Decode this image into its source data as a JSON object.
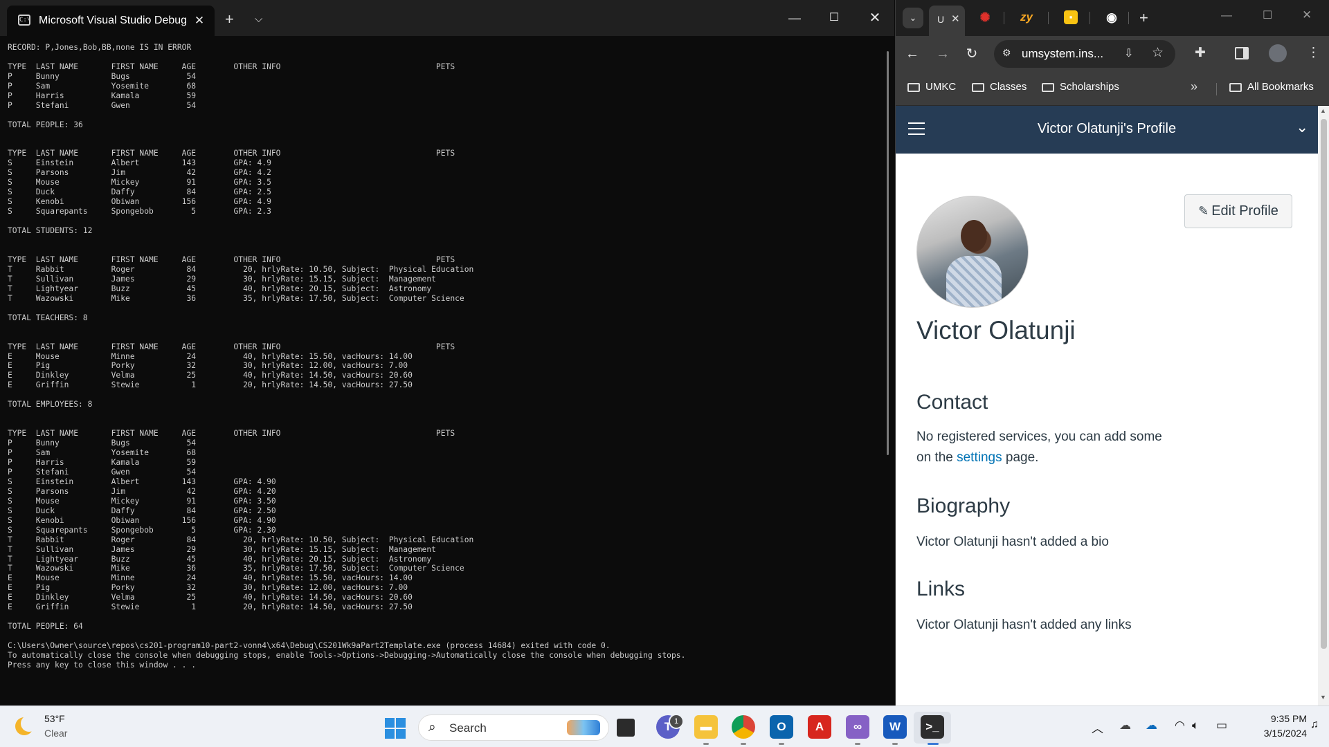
{
  "terminal": {
    "tab_title": "Microsoft Visual Studio Debug",
    "tab_icon": "terminal-icon",
    "new_tab_label": "+",
    "console_lines": [
      "RECORD: P,Jones,Bob,BB,none IS IN ERROR",
      "",
      "TYPE  LAST NAME       FIRST NAME     AGE        OTHER INFO                                 PETS",
      "P     Bunny           Bugs            54",
      "P     Sam             Yosemite        68",
      "P     Harris          Kamala          59",
      "P     Stefani         Gwen            54",
      "",
      "TOTAL PEOPLE: 36",
      "",
      "",
      "TYPE  LAST NAME       FIRST NAME     AGE        OTHER INFO                                 PETS",
      "S     Einstein        Albert         143        GPA: 4.9",
      "S     Parsons         Jim             42        GPA: 4.2",
      "S     Mouse           Mickey          91        GPA: 3.5",
      "S     Duck            Daffy           84        GPA: 2.5",
      "S     Kenobi          Obiwan         156        GPA: 4.9",
      "S     Squarepants     Spongebob        5        GPA: 2.3",
      "",
      "TOTAL STUDENTS: 12",
      "",
      "",
      "TYPE  LAST NAME       FIRST NAME     AGE        OTHER INFO                                 PETS",
      "T     Rabbit          Roger           84          20, hrlyRate: 10.50, Subject:  Physical Education",
      "T     Sullivan        James           29          30, hrlyRate: 15.15, Subject:  Management",
      "T     Lightyear       Buzz            45          40, hrlyRate: 20.15, Subject:  Astronomy",
      "T     Wazowski        Mike            36          35, hrlyRate: 17.50, Subject:  Computer Science",
      "",
      "TOTAL TEACHERS: 8",
      "",
      "",
      "TYPE  LAST NAME       FIRST NAME     AGE        OTHER INFO                                 PETS",
      "E     Mouse           Minne           24          40, hrlyRate: 15.50, vacHours: 14.00",
      "E     Pig             Porky           32          30, hrlyRate: 12.00, vacHours: 7.00",
      "E     Dinkley         Velma           25          40, hrlyRate: 14.50, vacHours: 20.60",
      "E     Griffin         Stewie           1          20, hrlyRate: 14.50, vacHours: 27.50",
      "",
      "TOTAL EMPLOYEES: 8",
      "",
      "",
      "TYPE  LAST NAME       FIRST NAME     AGE        OTHER INFO                                 PETS",
      "P     Bunny           Bugs            54",
      "P     Sam             Yosemite        68",
      "P     Harris          Kamala          59",
      "P     Stefani         Gwen            54",
      "S     Einstein        Albert         143        GPA: 4.90",
      "S     Parsons         Jim             42        GPA: 4.20",
      "S     Mouse           Mickey          91        GPA: 3.50",
      "S     Duck            Daffy           84        GPA: 2.50",
      "S     Kenobi          Obiwan         156        GPA: 4.90",
      "S     Squarepants     Spongebob        5        GPA: 2.30",
      "T     Rabbit          Roger           84          20, hrlyRate: 10.50, Subject:  Physical Education",
      "T     Sullivan        James           29          30, hrlyRate: 15.15, Subject:  Management",
      "T     Lightyear       Buzz            45          40, hrlyRate: 20.15, Subject:  Astronomy",
      "T     Wazowski        Mike            36          35, hrlyRate: 17.50, Subject:  Computer Science",
      "E     Mouse           Minne           24          40, hrlyRate: 15.50, vacHours: 14.00",
      "E     Pig             Porky           32          30, hrlyRate: 12.00, vacHours: 7.00",
      "E     Dinkley         Velma           25          40, hrlyRate: 14.50, vacHours: 20.60",
      "E     Griffin         Stewie           1          20, hrlyRate: 14.50, vacHours: 27.50",
      "",
      "TOTAL PEOPLE: 64",
      "",
      "C:\\Users\\Owner\\source\\repos\\cs201-program10-part2-vonn4\\x64\\Debug\\CS201Wk9aPart2Template.exe (process 14684) exited with code 0.",
      "To automatically close the console when debugging stops, enable Tools->Options->Debugging->Automatically close the console when debugging stops.",
      "Press any key to close this window . . ."
    ]
  },
  "browser": {
    "active_tab_title": "U",
    "tab_icons": [
      "canvas-icon",
      "zybooks-icon",
      "keep-icon",
      "chrome-icon"
    ],
    "zybooks_label": "zy",
    "url": "umsystem.ins...",
    "bookmarks": [
      "UMKC",
      "Classes",
      "Scholarships"
    ],
    "all_bookmarks_label": "All Bookmarks",
    "page": {
      "header_title": "Victor Olatunji's Profile",
      "edit_button_label": "Edit Profile",
      "name": "Victor Olatunji",
      "contact_heading": "Contact",
      "contact_text_before": "No registered services, you can add some on the ",
      "contact_link": "settings",
      "contact_text_after": " page.",
      "bio_heading": "Biography",
      "bio_text": "Victor Olatunji hasn't added a bio",
      "links_heading": "Links",
      "links_text": "Victor Olatunji hasn't added any links"
    }
  },
  "taskbar": {
    "weather_temp": "53°F",
    "weather_condition": "Clear",
    "search_placeholder": "Search",
    "teams_badge": "1",
    "time": "9:35 PM",
    "date": "3/15/2024",
    "apps": [
      "task-view",
      "teams",
      "file-explorer",
      "chrome",
      "outlook",
      "acrobat",
      "visual-studio",
      "word",
      "terminal"
    ]
  },
  "colors": {
    "canvas_header": "#263c55",
    "link": "#0374b5",
    "terminal_bg": "#0c0c0c",
    "taskbar_bg": "#eef1f6"
  }
}
